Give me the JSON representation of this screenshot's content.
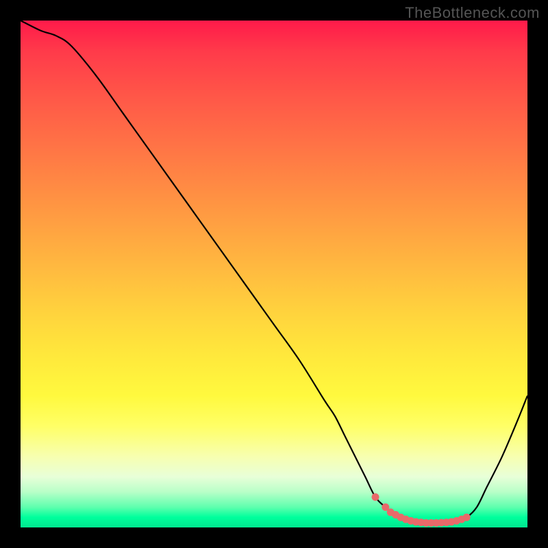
{
  "watermark": "TheBottleneck.com",
  "chart_data": {
    "type": "line",
    "title": "",
    "xlabel": "",
    "ylabel": "",
    "xlim": [
      0,
      100
    ],
    "ylim": [
      0,
      100
    ],
    "series": [
      {
        "name": "curve",
        "x": [
          0,
          4,
          7,
          10,
          15,
          20,
          25,
          30,
          35,
          40,
          45,
          50,
          55,
          60,
          62,
          64,
          66,
          68,
          70,
          72,
          74,
          76,
          78,
          80,
          82,
          84,
          86,
          88,
          90,
          92,
          95,
          98,
          100
        ],
        "y": [
          100,
          98,
          97,
          95,
          89,
          82,
          75,
          68,
          61,
          54,
          47,
          40,
          33,
          25,
          22,
          18,
          14,
          10,
          6,
          4,
          2.5,
          1.6,
          1.1,
          0.9,
          0.9,
          1.0,
          1.3,
          2.0,
          4.0,
          8,
          14,
          21,
          26
        ]
      }
    ],
    "highlighted_points": {
      "name": "minimum-region-dots",
      "color": "#e86a6a",
      "x": [
        70,
        72,
        73,
        74,
        75,
        76,
        77,
        78,
        79,
        80,
        81,
        82,
        83,
        84,
        85,
        86,
        87,
        88
      ],
      "y": [
        6.0,
        4.0,
        3.0,
        2.5,
        2.0,
        1.6,
        1.3,
        1.1,
        1.0,
        0.9,
        0.9,
        0.9,
        0.95,
        1.0,
        1.1,
        1.3,
        1.6,
        2.0
      ]
    },
    "background_gradient": {
      "top": "#ff1a4a",
      "mid": "#ffd43d",
      "bottom": "#00e890"
    }
  }
}
